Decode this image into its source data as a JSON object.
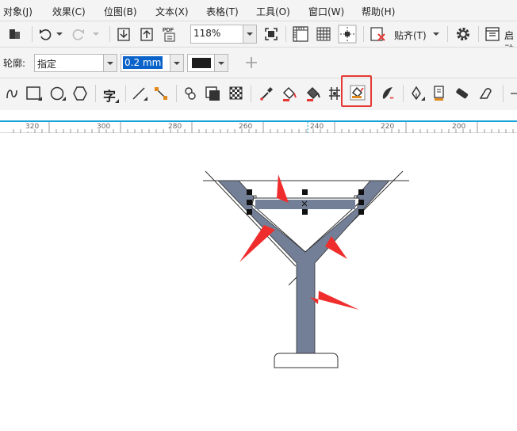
{
  "menu": {
    "items": [
      "对象(J)",
      "效果(C)",
      "位图(B)",
      "文本(X)",
      "表格(T)",
      "工具(O)",
      "窗口(W)",
      "帮助(H)"
    ]
  },
  "toolbar": {
    "zoom": "118%",
    "snap_label": "贴齐(T)",
    "launch_label": "启动"
  },
  "property_bar": {
    "outline_label": "轮廓:",
    "style_value": "指定",
    "width_value": "0.2 mm"
  },
  "toolbox": {
    "text_tool_glyph": "字"
  },
  "ruler": {
    "labels": [
      "320",
      "300",
      "280",
      "260",
      "240",
      "220",
      "200"
    ]
  },
  "colors": {
    "shape_fill": "#737f96",
    "arrow": "#f02d2d",
    "highlight": "#e53935",
    "ruler_line": "#15a3d9"
  },
  "icons": [
    "object-icon",
    "undo-icon",
    "redo-icon",
    "import-icon",
    "export-icon",
    "pdf-icon",
    "full-screen-icon",
    "rulers-icon",
    "grid-icon",
    "guidelines-icon",
    "snap-off-icon",
    "settings-icon",
    "launch-icon",
    "freehand-tool-icon",
    "rectangle-tool-icon",
    "ellipse-tool-icon",
    "polygon-tool-icon",
    "parallel-dimension-icon",
    "connector-icon",
    "shadow-tool-icon",
    "envelope-icon",
    "transparency-icon",
    "eyedropper-icon",
    "fill-tool-icon",
    "interactive-fill-icon",
    "mesh-fill-icon",
    "smart-fill-icon",
    "brush-icon",
    "pen-tool-icon",
    "color-eyedropper-icon",
    "eraser-icon",
    "knife-icon"
  ]
}
